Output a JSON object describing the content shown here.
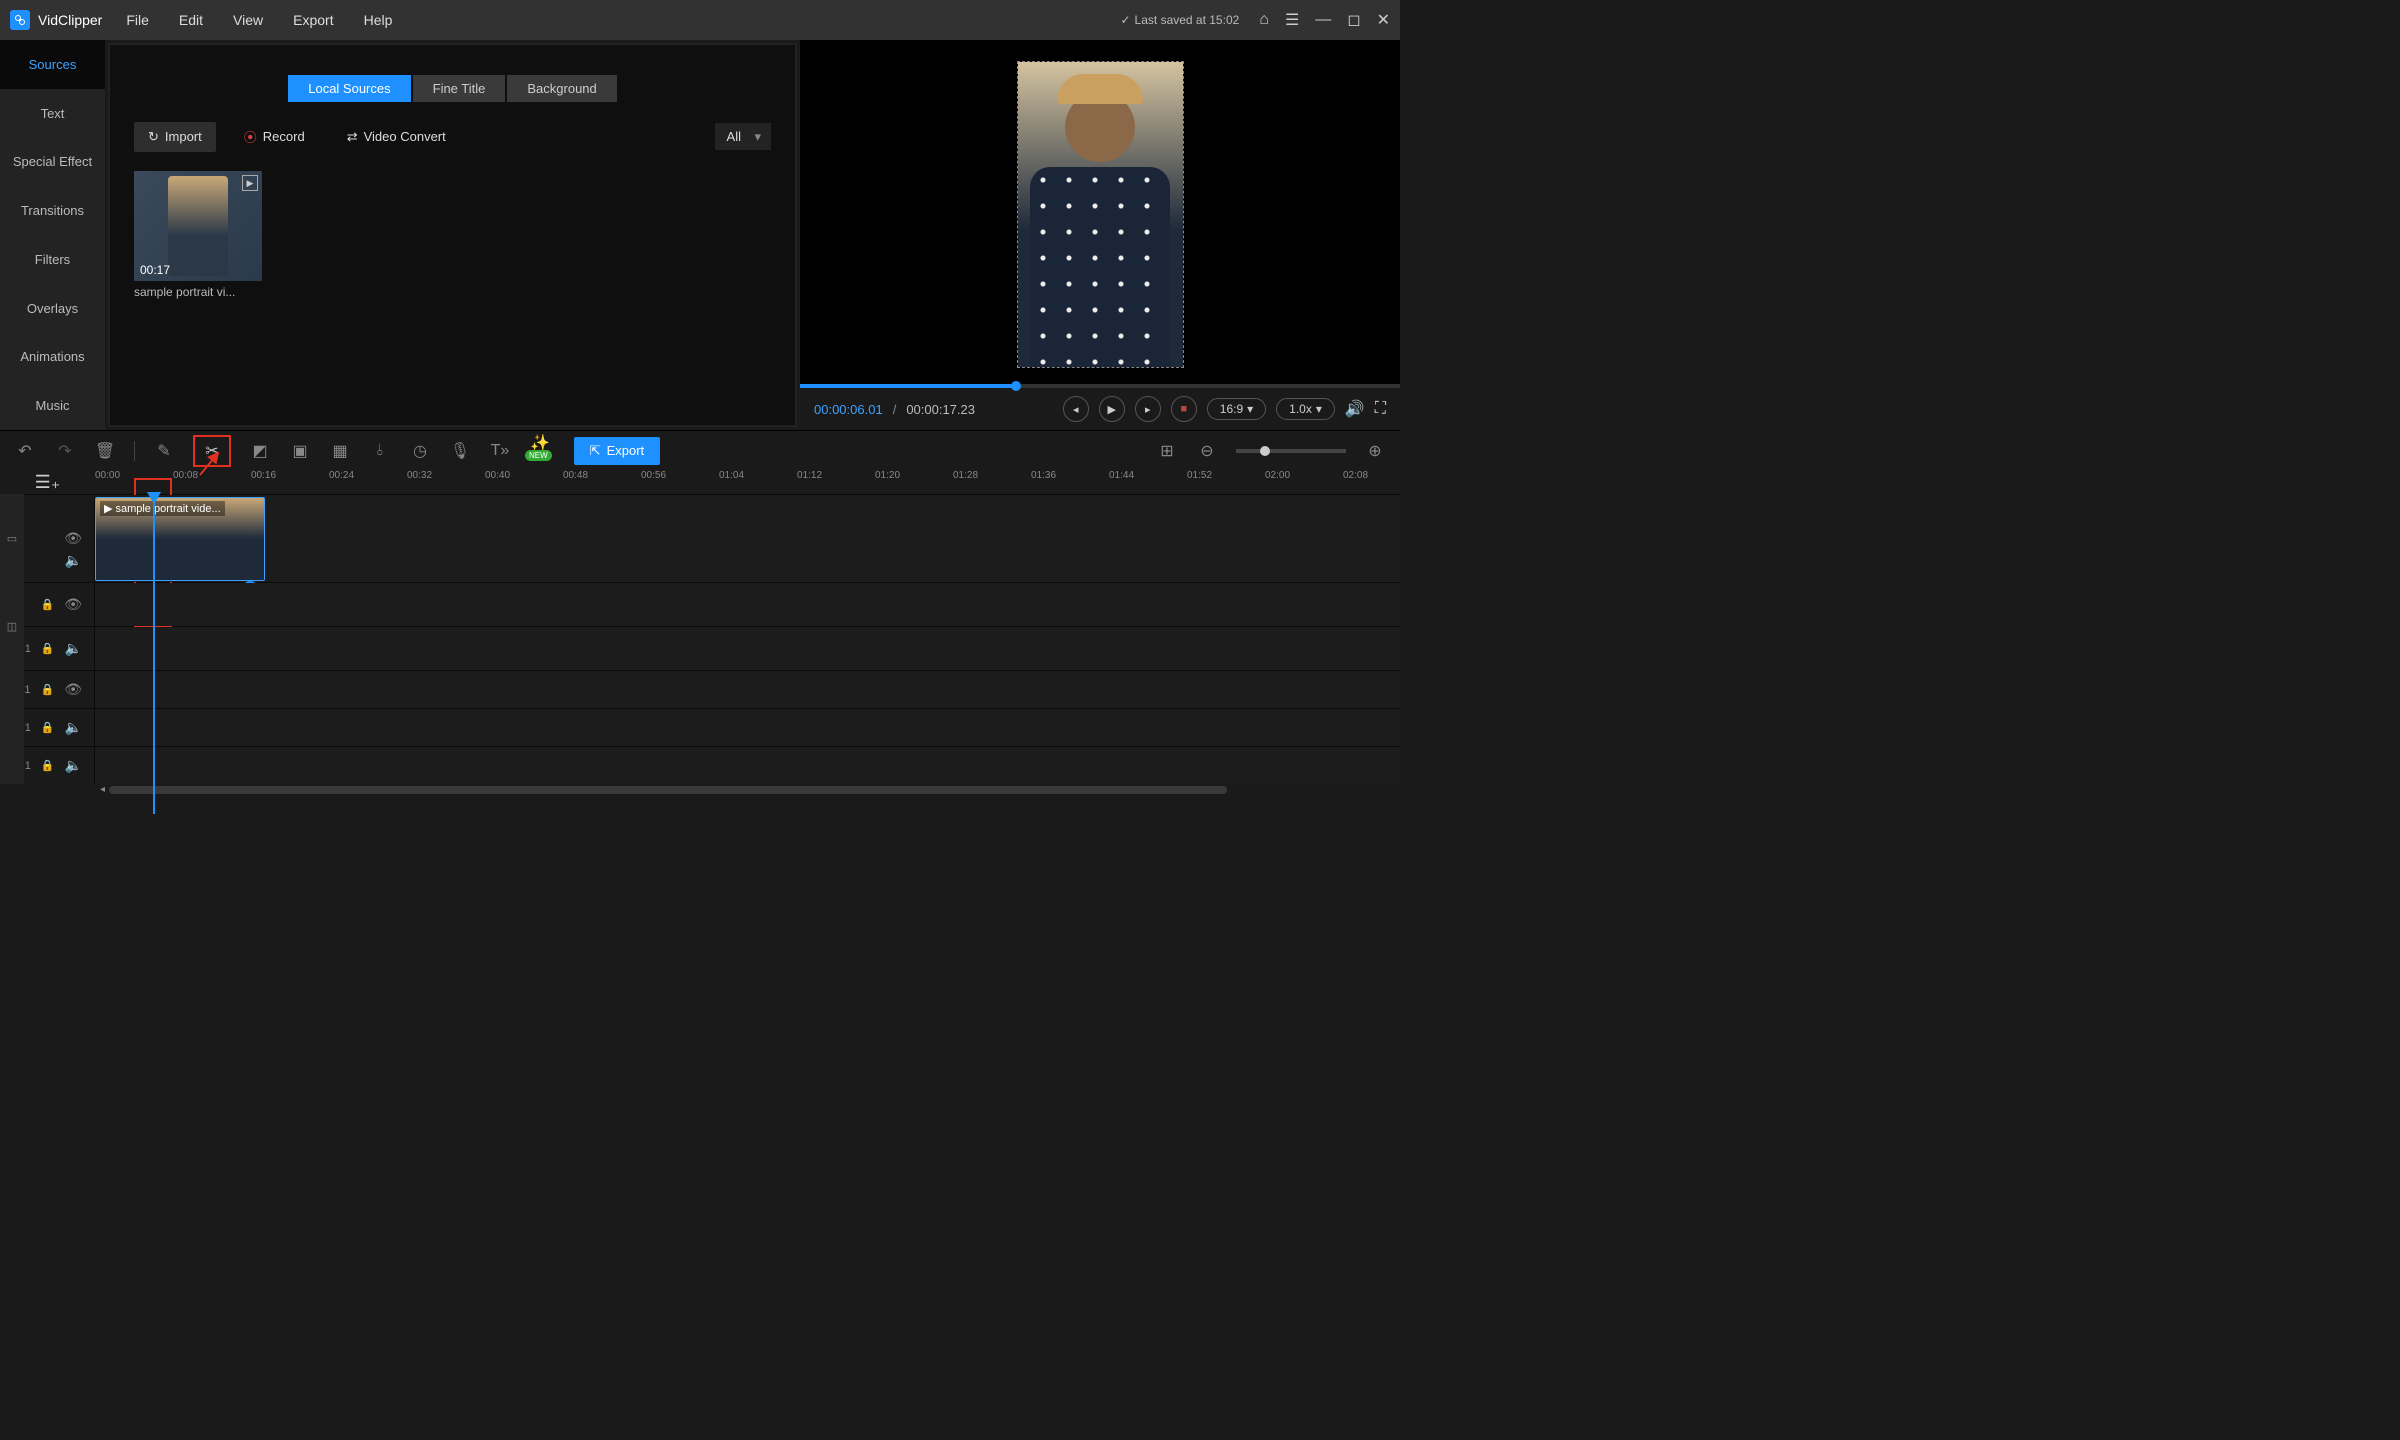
{
  "app": {
    "name": "VidClipper",
    "saved": "Last saved at 15:02"
  },
  "menu": {
    "file": "File",
    "edit": "Edit",
    "view": "View",
    "export": "Export",
    "help": "Help"
  },
  "sidebar": {
    "items": [
      {
        "label": "Sources",
        "active": true
      },
      {
        "label": "Text"
      },
      {
        "label": "Special Effect"
      },
      {
        "label": "Transitions"
      },
      {
        "label": "Filters"
      },
      {
        "label": "Overlays"
      },
      {
        "label": "Animations"
      },
      {
        "label": "Music"
      }
    ]
  },
  "panel": {
    "subtabs": {
      "local": "Local Sources",
      "fine": "Fine Title",
      "bg": "Background"
    },
    "tools": {
      "import": "Import",
      "record": "Record",
      "convert": "Video Convert"
    },
    "filter": "All",
    "media": {
      "duration": "00:17",
      "name": "sample portrait vi..."
    }
  },
  "preview": {
    "current": "00:00:06.01",
    "total": "00:00:17.23",
    "ratio": "16:9",
    "speed": "1.0x"
  },
  "toolbar": {
    "export": "Export",
    "new": "NEW"
  },
  "timeline": {
    "marks": [
      "00:00",
      "00:08",
      "00:16",
      "00:24",
      "00:32",
      "00:40",
      "00:48",
      "00:56",
      "01:04",
      "01:12",
      "01:20",
      "01:28",
      "01:36",
      "01:44",
      "01:52",
      "02:00",
      "02:08"
    ],
    "clip_label": "sample portrait vide...",
    "track_num": "1"
  }
}
